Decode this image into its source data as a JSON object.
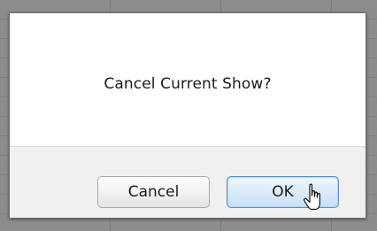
{
  "dialog": {
    "message": "Cancel Current Show?",
    "cancel_label": "Cancel",
    "ok_label": "OK"
  },
  "colors": {
    "ok_border": "#5b8ec4",
    "ok_fill": "#dcebf9",
    "button_bar": "#f0f0f0"
  },
  "cursor": {
    "icon": "hand-pointer-icon"
  }
}
